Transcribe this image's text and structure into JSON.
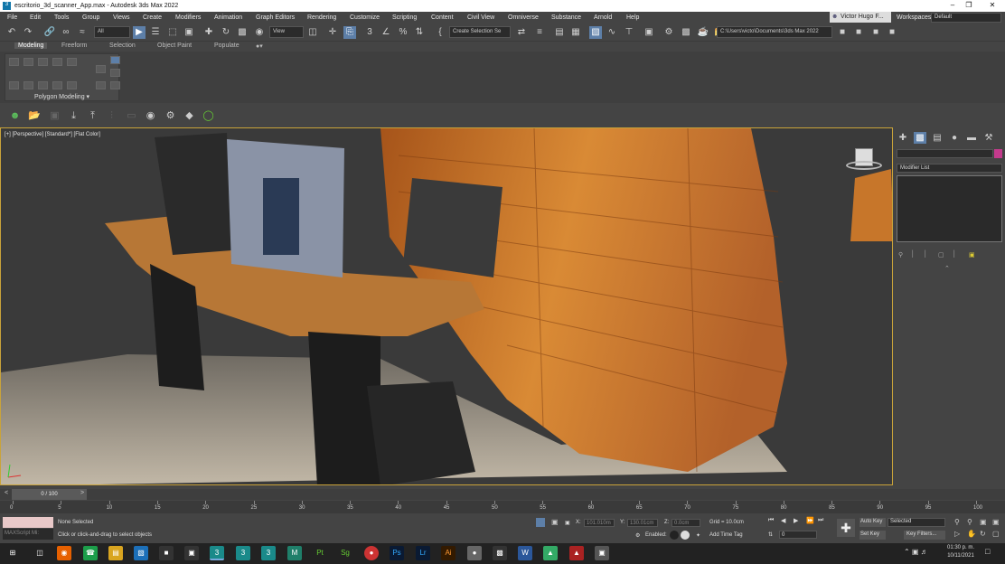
{
  "window": {
    "title": "escritorio_3d_scanner_App.max - Autodesk 3ds Max 2022"
  },
  "menu": [
    "File",
    "Edit",
    "Tools",
    "Group",
    "Views",
    "Create",
    "Modifiers",
    "Animation",
    "Graph Editors",
    "Rendering",
    "Customize",
    "Scripting",
    "Content",
    "Civil View",
    "Omniverse",
    "Substance",
    "Arnold",
    "Help"
  ],
  "user": {
    "name": "Victor Hugo F...",
    "workspaces_label": "Workspaces:",
    "workspace": "Default"
  },
  "toolbar": {
    "filter": "All",
    "refcoord": "View",
    "selection_set": "Create Selection Se",
    "path": "C:\\Users\\victo\\Documents\\3ds Max 2022"
  },
  "ribbon": {
    "tabs": [
      "Modeling",
      "Freeform",
      "Selection",
      "Object Paint",
      "Populate"
    ],
    "panel_label": "Polygon Modeling ▾"
  },
  "viewport": {
    "label": "[+] [Perspective] [Standard*] [Flat Color]"
  },
  "command_panel": {
    "modifier_list": "Modifier List"
  },
  "timeline": {
    "slider": "0 / 100",
    "ticks": [
      "0",
      "5",
      "10",
      "15",
      "20",
      "25",
      "30",
      "35",
      "40",
      "45",
      "50",
      "55",
      "60",
      "65",
      "70",
      "75",
      "80",
      "85",
      "90",
      "95",
      "100"
    ]
  },
  "status": {
    "maxscript": "MAXScript Mi:",
    "selected": "None Selected",
    "prompt": "Click or click-and-drag to select objects",
    "x_label": "X:",
    "x_value": "101.010m",
    "y_label": "Y:",
    "y_value": "130.01cm",
    "z_label": "Z:",
    "z_value": "0.0cm",
    "grid": "Grid = 10.0cm",
    "enabled": "Enabled:",
    "add_time_tag": "Add Time Tag",
    "autokey": "Auto Key",
    "setkey": "Set Key",
    "selected_dd": "Selected",
    "key_filters": "Key Filters...",
    "frame": "0"
  },
  "taskbar": {
    "time": "01:30 p. m.",
    "date": "10/11/2021"
  },
  "colors": {
    "viewport_border": "#c9a33a",
    "accent": "#5d7fa8",
    "wood": "#c7762a"
  }
}
